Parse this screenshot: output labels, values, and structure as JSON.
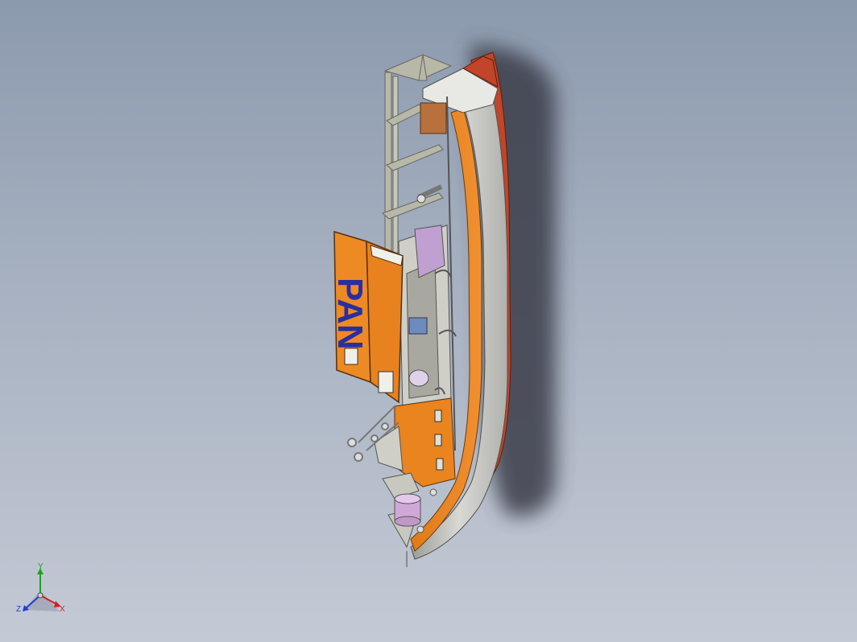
{
  "viewport": {
    "background_top": "#8c9aae",
    "background_bottom": "#c4cad5"
  },
  "model": {
    "hull_lettering": "PAN",
    "colors": {
      "hull_orange": "#e8821e",
      "hull_red": "#c0452a",
      "hull_grey": "#c8c8c4",
      "frame_grey": "#b8b8a8",
      "lettering": "#2a2fa0"
    }
  },
  "triad": {
    "x_label": "X",
    "y_label": "Y",
    "z_label": "Z",
    "x_color": "#d02020",
    "y_color": "#20a020",
    "z_color": "#2040d0"
  }
}
